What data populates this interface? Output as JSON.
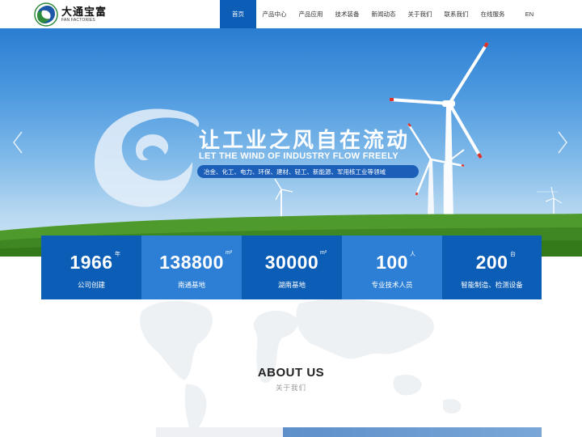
{
  "brand": {
    "name_cn": "大通宝富",
    "name_en": "FAN FACTORIES",
    "colors": {
      "primary": "#0c5db5",
      "secondary": "#2d7fd6",
      "logo_green": "#2e8b3a"
    }
  },
  "nav": {
    "items": [
      {
        "label": "首页",
        "active": true
      },
      {
        "label": "产品中心",
        "active": false
      },
      {
        "label": "产品应用",
        "active": false
      },
      {
        "label": "技术装备",
        "active": false
      },
      {
        "label": "新闻动态",
        "active": false
      },
      {
        "label": "关于我们",
        "active": false
      },
      {
        "label": "联系我们",
        "active": false
      },
      {
        "label": "在线服务",
        "active": false
      },
      {
        "label": "EN",
        "active": false
      }
    ]
  },
  "hero": {
    "slogan_cn": "让工业之风自在流动",
    "slogan_en": "LET THE WIND OF INDUSTRY FLOW FREELY",
    "industries": "冶金、化工、电力、环保、建材、轻工、新能源、军用核工业等领域",
    "prev_icon": "chevron-left-icon",
    "next_icon": "chevron-right-icon"
  },
  "stats": [
    {
      "number": "1966",
      "sup": "年",
      "label": "公司创建"
    },
    {
      "number": "138800",
      "sup": "m²",
      "label": "南通基地"
    },
    {
      "number": "30000",
      "sup": "m²",
      "label": "湖南基地"
    },
    {
      "number": "100",
      "sup": "人",
      "label": "专业技术人员"
    },
    {
      "number": "200",
      "sup": "台",
      "label": "智能制造、检测设备"
    }
  ],
  "about": {
    "title": "ABOUT US",
    "subtitle": "关于我们"
  }
}
